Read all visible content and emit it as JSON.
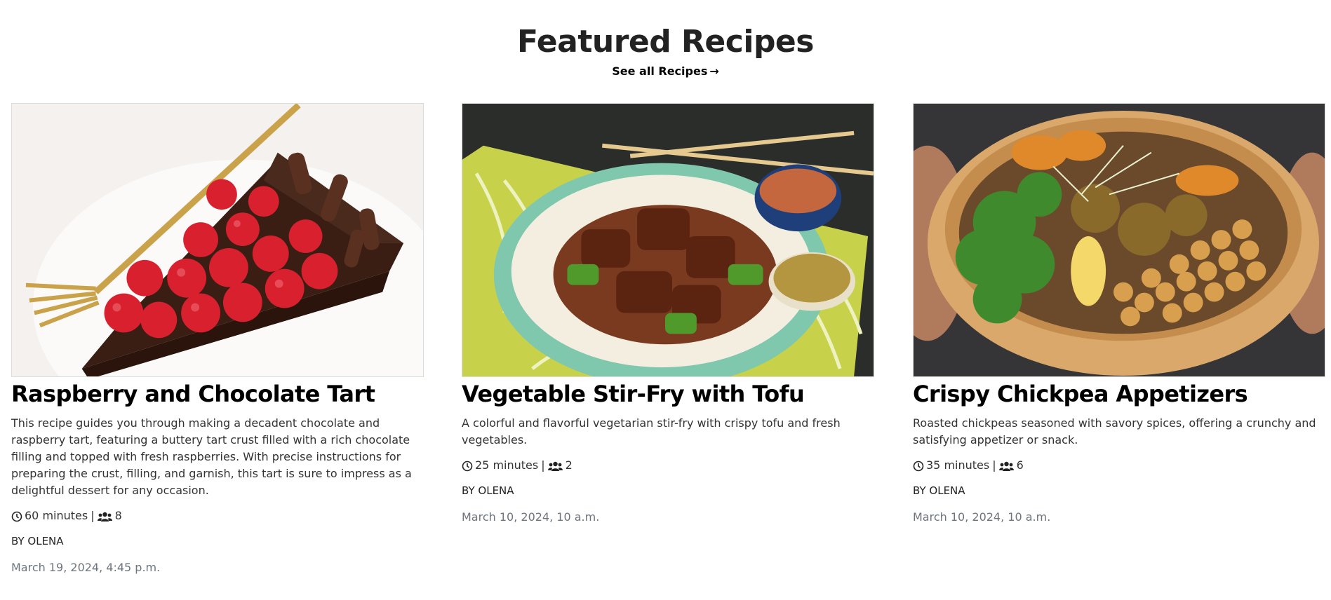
{
  "header": {
    "title": "Featured Recipes",
    "see_all_label": "See all Recipes",
    "see_all_arrow": "→"
  },
  "recipes": [
    {
      "title": "Raspberry and Chocolate Tart",
      "description": "This recipe guides you through making a decadent chocolate and raspberry tart, featuring a buttery tart crust filled with a rich chocolate filling and topped with fresh raspberries. With precise instructions for preparing the crust, filling, and garnish, this tart is sure to impress as a delightful dessert for any occasion.",
      "time": "60 minutes",
      "separator": "|",
      "servings": "8",
      "author": "BY OLENA",
      "date": "March 19, 2024, 4:45 p.m.",
      "image_icon": "tart-photo"
    },
    {
      "title": "Vegetable Stir-Fry with Tofu",
      "description": "A colorful and flavorful vegetarian stir-fry with crispy tofu and fresh vegetables.",
      "time": "25 minutes",
      "separator": "|",
      "servings": "2",
      "author": "BY OLENA",
      "date": "March 10, 2024, 10 a.m.",
      "image_icon": "stir-fry-photo"
    },
    {
      "title": "Crispy Chickpea Appetizers",
      "description": "Roasted chickpeas seasoned with savory spices, offering a crunchy and satisfying appetizer or snack.",
      "time": "35 minutes",
      "separator": "|",
      "servings": "6",
      "author": "BY OLENA",
      "date": "March 10, 2024, 10 a.m.",
      "image_icon": "chickpea-bowl-photo"
    }
  ],
  "icons": {
    "time": "clock-icon",
    "servings": "users-icon"
  },
  "colors": {
    "title": "#000000",
    "text": "#333333",
    "date": "#6c757d"
  }
}
